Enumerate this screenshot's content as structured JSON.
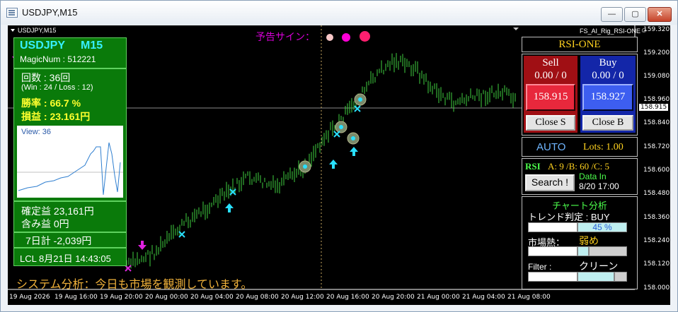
{
  "window": {
    "title": "USDJPY,M15"
  },
  "chart": {
    "symbol_label": "USDJPY,M15",
    "indicator_name": "FS_AI_Rig_RSI-ONE",
    "signal_label": "予告サイン：",
    "current_price": "158.915",
    "price_axis": [
      "159.320",
      "159.200",
      "159.080",
      "158.960",
      "158.840",
      "158.720",
      "158.600",
      "158.480",
      "158.360",
      "158.240",
      "158.120",
      "158.000"
    ],
    "time_axis": [
      "19 Aug 2026",
      "19 Aug 16:00",
      "19 Aug 20:00",
      "20 Aug 00:00",
      "20 Aug 04:00",
      "20 Aug 08:00",
      "20 Aug 12:00",
      "20 Aug 16:00",
      "20 Aug 20:00",
      "21 Aug 00:00",
      "21 Aug 04:00",
      "21 Aug 08:00"
    ],
    "status_message": "システム分析：今日も市場を観測しています。",
    "colors": {
      "candle": "#3fd13f",
      "signal_pink": "#ff1493",
      "signal_magenta": "#d500d5",
      "arrow_cyan": "#29e0ff"
    }
  },
  "left_panel": {
    "symbol": "USDJPY",
    "timeframe": "M15",
    "magic": "MagicNum : 512221",
    "count": "回数 : 36回",
    "win_loss": "(Win : 24 /  Loss :  12)",
    "winrate": "勝率 : 66.7 %",
    "pnl": "損益 : 23.161円",
    "view": "View: 36",
    "realized": "確定益 23,161円",
    "unrealized": "含み益 0円",
    "week": "7日計 -2,039円",
    "time": "LCL 8月21日 14:43:05"
  },
  "right_panel": {
    "name": "RSI-ONE",
    "sell_label": "Sell",
    "sell_count": "0.00 / 0",
    "sell_price": "158.915",
    "close_sell": "Close S",
    "buy_label": "Buy",
    "buy_count": "0.00 / 0",
    "buy_price": "158.927",
    "close_buy": "Close B",
    "auto": "AUTO",
    "lots": "Lots: 1.00",
    "rsi_label": "RSI",
    "rsi_values": "A: 9 /B: 60 /C: 5",
    "search": "Search !",
    "data_in": "Data In",
    "data_in_time": "8/20 17:00",
    "analysis_title": "チャート分析",
    "trend": "トレンド判定 : BUY",
    "trend_pct": "45 %",
    "heat_label": "市場熱：",
    "heat_value": "弱め",
    "filter_label": "Filter :",
    "filter_value": "クリーン"
  }
}
